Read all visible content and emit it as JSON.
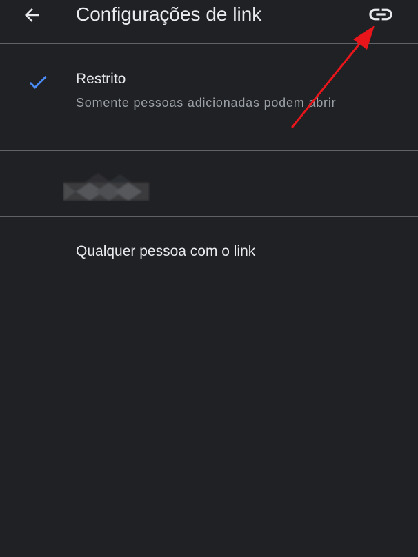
{
  "header": {
    "title": "Configurações de link",
    "back_icon": "arrow-back-icon",
    "link_icon": "link-icon"
  },
  "options": [
    {
      "title": "Restrito",
      "description": "Somente pessoas adicionadas podem abrir",
      "selected": true,
      "check_icon": "check-icon"
    },
    {
      "title": "",
      "redacted": true
    },
    {
      "title": "Qualquer pessoa com o link",
      "selected": false
    }
  ],
  "colors": {
    "background": "#202124",
    "divider": "#5f6368",
    "text_primary": "#e8eaed",
    "text_secondary": "#9aa0a6",
    "check": "#4a8df8",
    "annotation": "#e8151b"
  }
}
